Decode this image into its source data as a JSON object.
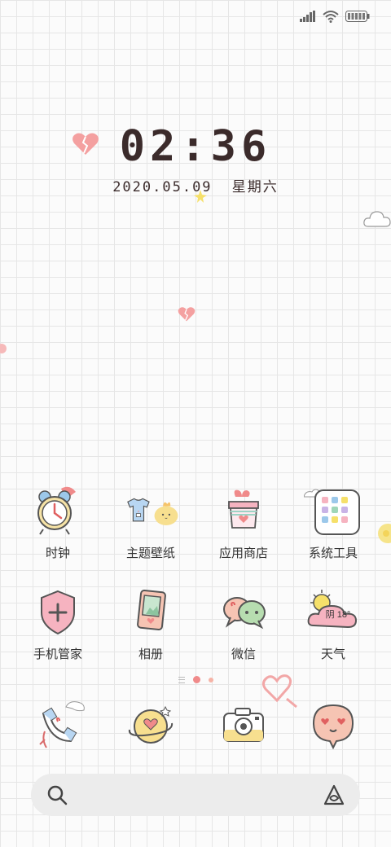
{
  "status_bar": {
    "icons": [
      "signal-icon",
      "wifi-icon",
      "battery-icon"
    ]
  },
  "lockscreen": {
    "time": "02:36",
    "date": "2020.05.09",
    "weekday": "星期六"
  },
  "apps": [
    {
      "label": "时钟",
      "icon": "alarm-clock-icon"
    },
    {
      "label": "主题壁纸",
      "icon": "theme-wallpaper-icon"
    },
    {
      "label": "应用商店",
      "icon": "app-store-icon"
    },
    {
      "label": "系统工具",
      "icon": "system-tools-folder-icon"
    },
    {
      "label": "手机管家",
      "icon": "phone-manager-shield-icon"
    },
    {
      "label": "相册",
      "icon": "gallery-icon"
    },
    {
      "label": "微信",
      "icon": "wechat-icon"
    },
    {
      "label": "天气",
      "icon": "weather-icon",
      "badge": "阴 18°"
    }
  ],
  "page_indicator": {
    "pages": 3,
    "current": 2
  },
  "dock": [
    {
      "icon": "phone-icon"
    },
    {
      "icon": "browser-planet-icon"
    },
    {
      "icon": "camera-icon"
    },
    {
      "icon": "messages-icon"
    }
  ],
  "search_bar": {
    "left_icon": "search-icon",
    "right_icon": "assistant-icon"
  },
  "colors": {
    "accent_pink": "#f08a8a",
    "text_dark": "#3b2b2b"
  }
}
